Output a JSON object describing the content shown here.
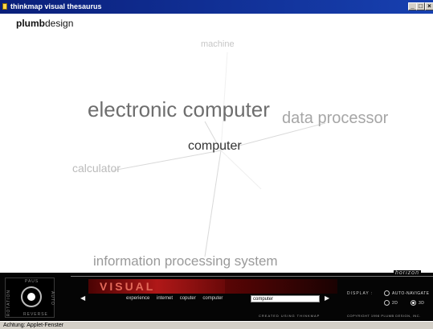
{
  "window": {
    "title": "thinkmap visual thesaurus",
    "controls": {
      "minimize": "_",
      "maximize": "□",
      "close": "×"
    }
  },
  "brand": {
    "bold": "plumb",
    "regular": "design"
  },
  "thesaurus": {
    "center_word": "computer",
    "related_words": {
      "machine": "machine",
      "electronic_computer": "electronic computer",
      "data_processor": "data processor",
      "calculator": "calculator",
      "information_processing_system": "information processing system"
    }
  },
  "panel": {
    "horizon_label": "horizon",
    "dial_labels": {
      "top": "PAUS",
      "bottom": "REVERSE",
      "left": "ROTATION",
      "right": "AUTO"
    },
    "logo_text": "VISUAL THESAURUS",
    "history": [
      "experience",
      "internet",
      "coputer",
      "computer"
    ],
    "search": {
      "value": "computer"
    },
    "credits": "CREATED USING THINKMAP",
    "copyright": "COPYRIGHT 1998 PLUMB DESIGN, INC.",
    "display": {
      "label": "DISPLAY :",
      "auto_navigate": "AUTO-NAVIGATE",
      "mode_2d": "2D",
      "mode_3d": "3D",
      "selected_mode": "3D"
    }
  },
  "statusbar": {
    "text": "Achtung: Applet-Fenster"
  },
  "colors": {
    "titlebar": "#0a1f7a",
    "panel_background": "#050505",
    "logo_red": "#b01818"
  }
}
